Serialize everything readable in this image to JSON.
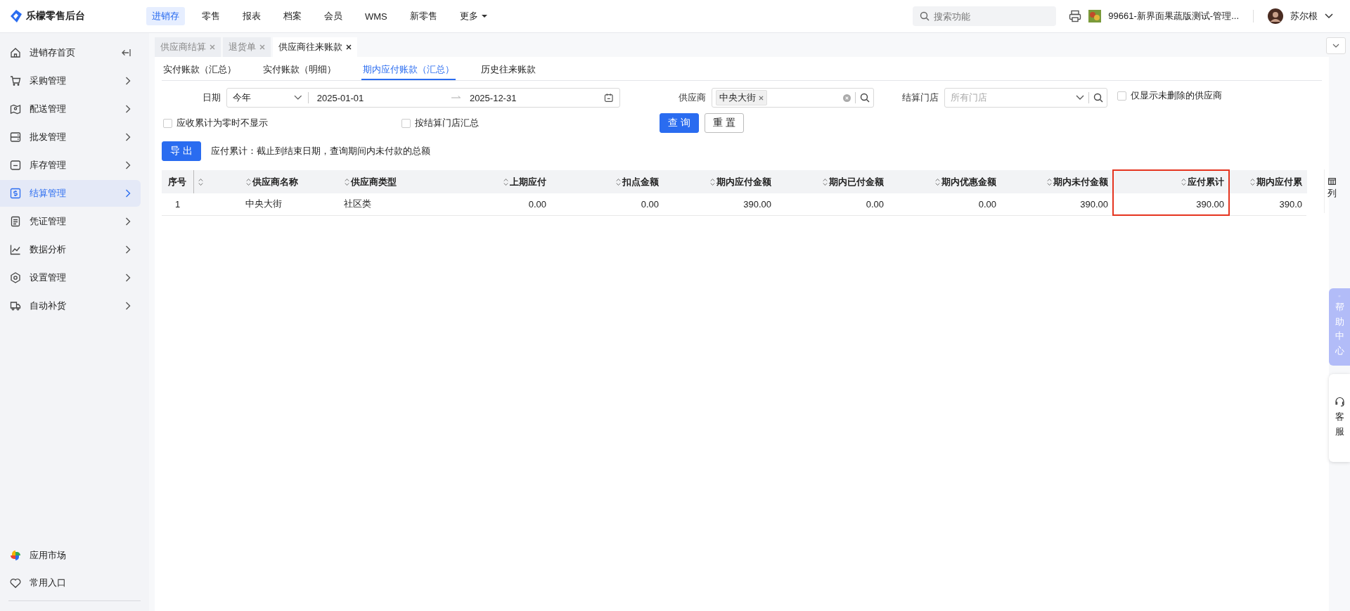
{
  "app": {
    "title": "乐檬零售后台"
  },
  "top_nav": [
    {
      "label": "进销存",
      "selected": true,
      "dropdown": false
    },
    {
      "label": "零售",
      "selected": false,
      "dropdown": false
    },
    {
      "label": "报表",
      "selected": false,
      "dropdown": false
    },
    {
      "label": "档案",
      "selected": false,
      "dropdown": false
    },
    {
      "label": "会员",
      "selected": false,
      "dropdown": false
    },
    {
      "label": "WMS",
      "selected": false,
      "dropdown": false
    },
    {
      "label": "新零售",
      "selected": false,
      "dropdown": false
    },
    {
      "label": "更多",
      "selected": false,
      "dropdown": true
    }
  ],
  "search": {
    "placeholder": "搜索功能"
  },
  "store": {
    "name": "99661-新界面果蔬版测试-管理..."
  },
  "user": {
    "name": "苏尔根"
  },
  "sidebar": {
    "items": [
      {
        "label": "进销存首页",
        "selected": false,
        "kind": "home"
      },
      {
        "label": "采购管理",
        "selected": false,
        "kind": "menu"
      },
      {
        "label": "配送管理",
        "selected": false,
        "kind": "menu"
      },
      {
        "label": "批发管理",
        "selected": false,
        "kind": "menu"
      },
      {
        "label": "库存管理",
        "selected": false,
        "kind": "menu"
      },
      {
        "label": "结算管理",
        "selected": true,
        "kind": "menu"
      },
      {
        "label": "凭证管理",
        "selected": false,
        "kind": "menu"
      },
      {
        "label": "数据分析",
        "selected": false,
        "kind": "menu"
      },
      {
        "label": "设置管理",
        "selected": false,
        "kind": "menu"
      },
      {
        "label": "自动补货",
        "selected": false,
        "kind": "menu"
      }
    ],
    "bottom_items": [
      {
        "label": "应用市场"
      },
      {
        "label": "常用入口"
      }
    ]
  },
  "page_tabs": [
    {
      "label": "供应商结算",
      "selected": false
    },
    {
      "label": "退货单",
      "selected": false
    },
    {
      "label": "供应商往来账款",
      "selected": true
    }
  ],
  "sub_tabs": [
    {
      "label": "实付账款（汇总）",
      "selected": false
    },
    {
      "label": "实付账款（明细）",
      "selected": false
    },
    {
      "label": "期内应付账款（汇总）",
      "selected": true
    },
    {
      "label": "历史往来账款",
      "selected": false
    }
  ],
  "filters": {
    "date": {
      "label": "日期",
      "range": "今年",
      "start": "2025-01-01",
      "end": "2025-12-31"
    },
    "supplier": {
      "label": "供应商",
      "tag": "中央大街"
    },
    "store": {
      "label": "结算门店",
      "placeholder": "所有门店"
    },
    "only_undeleted": {
      "label": "仅显示未删除的供应商",
      "checked": false
    },
    "hide_zero": {
      "label": "应收累计为零时不显示",
      "checked": false
    },
    "by_store": {
      "label": "按结算门店汇总",
      "checked": false
    }
  },
  "buttons": {
    "query": "查 询",
    "reset": "重 置",
    "export": "导 出"
  },
  "note": "应付累计：截止到结束日期，查询期间内未付款的总额",
  "table": {
    "columns": [
      {
        "label": "序号",
        "sortable": false,
        "highlighted": false
      },
      {
        "sortable": true,
        "highlighted": false
      },
      {
        "label": "供应商名称",
        "sortable": true,
        "highlighted": false
      },
      {
        "label": "供应商类型",
        "sortable": true,
        "highlighted": false
      },
      {
        "label": "上期应付",
        "sortable": true,
        "highlighted": false
      },
      {
        "label": "扣点金额",
        "sortable": true,
        "highlighted": false
      },
      {
        "label": "期内应付金额",
        "sortable": true,
        "highlighted": false
      },
      {
        "label": "期内已付金额",
        "sortable": true,
        "highlighted": false
      },
      {
        "label": "期内优惠金额",
        "sortable": true,
        "highlighted": false
      },
      {
        "label": "期内未付金额",
        "sortable": true,
        "highlighted": false
      },
      {
        "label": "应付累计",
        "sortable": true,
        "highlighted": true
      },
      {
        "label": "期内应付累",
        "sortable": true,
        "highlighted": false
      }
    ],
    "rows": [
      {
        "cells": [
          "1",
          "",
          "中央大街",
          "社区类",
          "0.00",
          "0.00",
          "390.00",
          "0.00",
          "0.00",
          "390.00",
          "390.00",
          "390.0"
        ]
      }
    ]
  },
  "column_settings": {
    "label": "列"
  },
  "side_tabs": [
    {
      "label": "帮助中心",
      "kind": "help"
    },
    {
      "label": "客服",
      "kind": "service"
    }
  ]
}
